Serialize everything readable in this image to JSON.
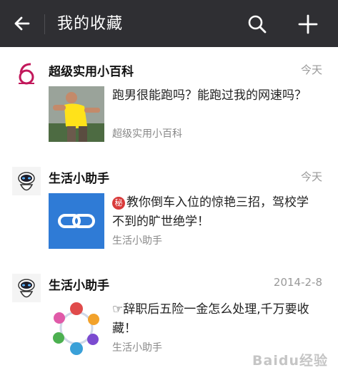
{
  "header": {
    "title": "我的收藏",
    "back_icon": "arrow-left-icon",
    "search_icon": "search-icon",
    "add_icon": "plus-icon",
    "background": "#2f2f33"
  },
  "favorites": [
    {
      "source": "超级实用小百科",
      "time": "今天",
      "headline": "跑男很能跑吗？能跑过我的网速吗？",
      "subtitle": "超级实用小百科",
      "avatar_icon": "number-6-logo-icon",
      "thumb": "running-man-photo"
    },
    {
      "source": "生活小助手",
      "time": "今天",
      "badge": "秘",
      "headline": "教你倒车入位的惊艳三招，驾校学不到的旷世绝学！",
      "subtitle": "生活小助手",
      "avatar_icon": "robot-avatar-icon",
      "thumb": "link-icon",
      "thumb_color": "#2f7bd6"
    },
    {
      "source": "生活小助手",
      "time": "2014-2-8",
      "headline": "☞辞职后五险一金怎么处理,千万要收藏！",
      "subtitle": "生活小助手",
      "avatar_icon": "robot-avatar-icon",
      "thumb": "insurance-circle-diagram"
    }
  ],
  "watermark": "Baidu经验"
}
